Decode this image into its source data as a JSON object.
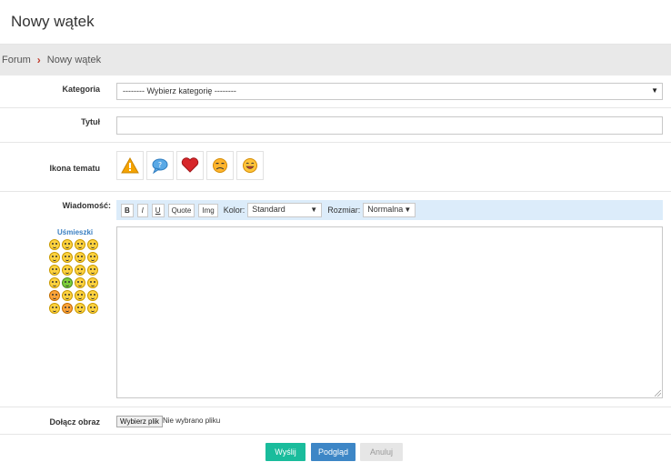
{
  "page": {
    "title": "Nowy wątek"
  },
  "breadcrumb": {
    "root": "Forum",
    "separator": "›",
    "current": "Nowy wątek"
  },
  "form": {
    "category": {
      "label": "Kategoria",
      "value": "-------- Wybierz kategorię --------"
    },
    "title": {
      "label": "Tytuł",
      "value": ""
    },
    "topic_icon": {
      "label": "Ikona tematu",
      "icons": [
        "warning-icon",
        "question-bubble-icon",
        "heart-icon",
        "angry-face-icon",
        "laughing-face-icon"
      ]
    },
    "message": {
      "label": "Wiadomość:",
      "smileys_label": "Uśmieszki",
      "toolbar": {
        "bold": "B",
        "italic": "I",
        "underline": "U",
        "quote": "Quote",
        "img": "Img",
        "color_label": "Kolor:",
        "color_value": "Standard",
        "size_label": "Rozmiar:",
        "size_value": "Normalna"
      },
      "value": ""
    },
    "attach": {
      "label": "Dołącz obraz",
      "button": "Wybierz plik",
      "status": "Nie wybrano pliku"
    }
  },
  "actions": {
    "send": "Wyślij",
    "preview": "Podgląd",
    "cancel": "Anuluj"
  },
  "colors": {
    "send": "#1abc9c",
    "preview": "#3d86c6",
    "cancel": "#e6e6e6",
    "toolbar_bg": "#dcecfa",
    "breadcrumb_bg": "#e9e9e9"
  }
}
